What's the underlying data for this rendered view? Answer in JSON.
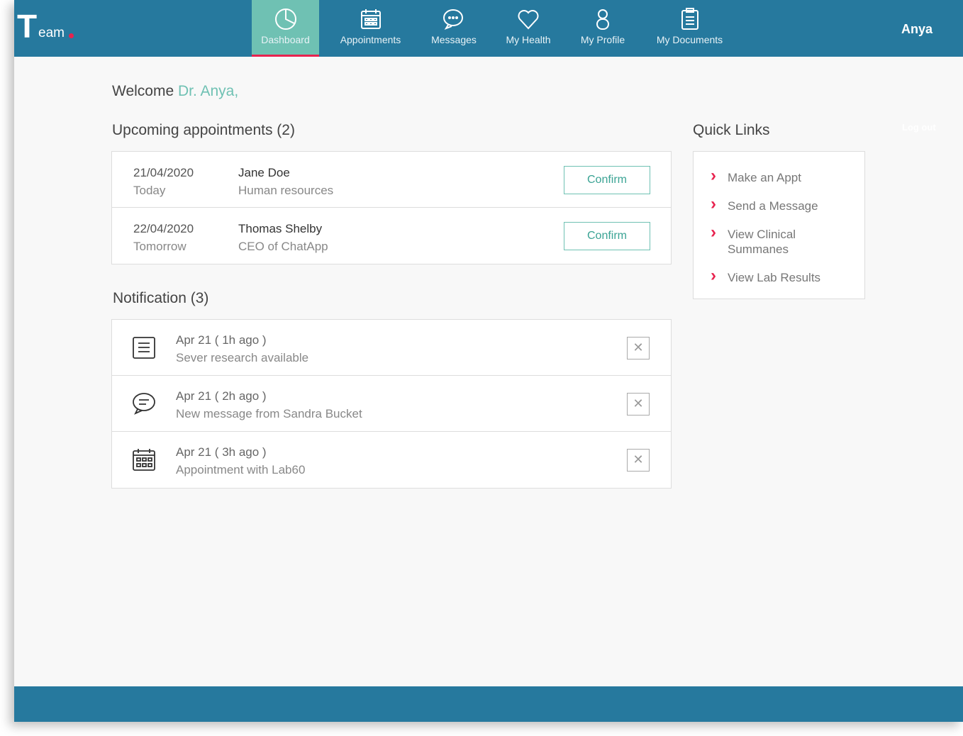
{
  "brand": {
    "letter": "T",
    "rest": "eam"
  },
  "nav": [
    {
      "label": "Dashboard",
      "icon": "pie-chart-icon"
    },
    {
      "label": "Appointments",
      "icon": "calendar-icon"
    },
    {
      "label": "Messages",
      "icon": "chat-icon"
    },
    {
      "label": "My Health",
      "icon": "heart-icon"
    },
    {
      "label": "My Profile",
      "icon": "person-icon"
    },
    {
      "label": "My Documents",
      "icon": "clipboard-icon"
    }
  ],
  "user": "Anya",
  "logout": "Log out",
  "welcome": {
    "prefix": "Welcome ",
    "name": "Dr. Anya,"
  },
  "appointments": {
    "title": "Upcoming appointments (2)",
    "items": [
      {
        "date": "21/04/2020",
        "relative": "Today",
        "name": "Jane Doe",
        "role": "Human resources",
        "action": "Confirm"
      },
      {
        "date": "22/04/2020",
        "relative": "Tomorrow",
        "name": "Thomas Shelby",
        "role": "CEO of ChatApp",
        "action": "Confirm"
      }
    ]
  },
  "notifications": {
    "title": "Notification (3)",
    "items": [
      {
        "time": "Apr 21 ( 1h ago )",
        "text": "Sever research available",
        "icon": "document-icon"
      },
      {
        "time": "Apr 21 ( 2h ago )",
        "text": "New message from Sandra Bucket",
        "icon": "chat-icon"
      },
      {
        "time": "Apr 21 ( 3h  ago )",
        "text": "Appointment with Lab60",
        "icon": "calendar-icon"
      }
    ]
  },
  "quick_links": {
    "title": "Quick Links",
    "items": [
      "Make an Appt",
      "Send a Message",
      "View Clinical Summanes",
      "View Lab Results"
    ]
  },
  "colors": {
    "header": "#26799e",
    "active": "#6fc1b3",
    "accent": "#e8234f"
  }
}
